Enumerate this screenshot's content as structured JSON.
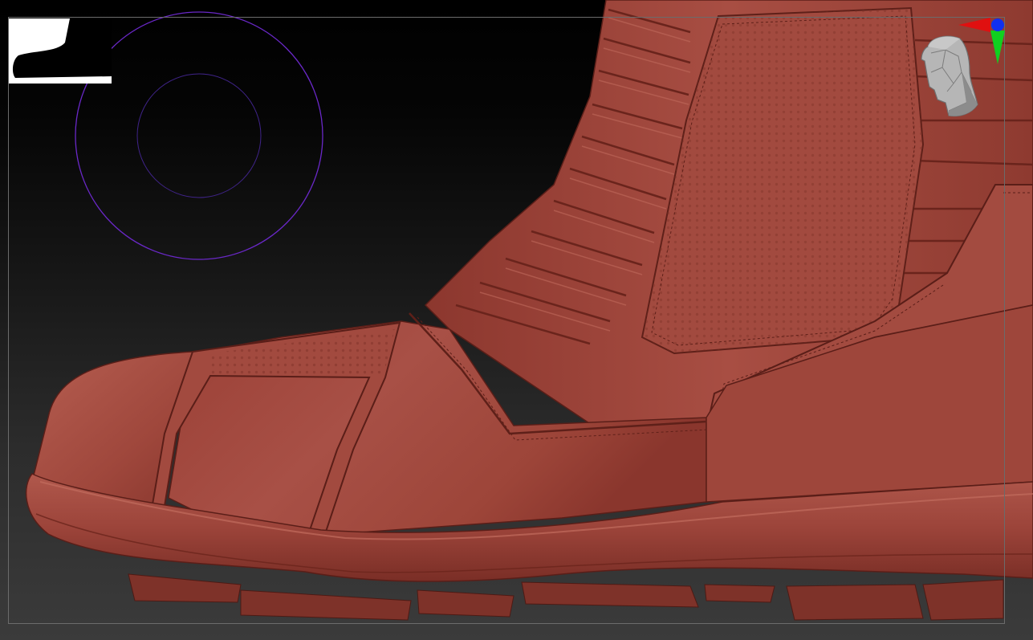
{
  "app": {
    "name": "",
    "view": "3d-viewport"
  },
  "viewport": {
    "background_top": "#000000",
    "background_bottom": "#3b3b3b",
    "frame_color": "#6b6b6b"
  },
  "model": {
    "subject": "boot",
    "material_color": "#a0463c",
    "highlight_color": "#c06a5c",
    "shadow_color": "#5a1e18"
  },
  "brush": {
    "outer_ring_color": "#6a28c8",
    "inner_ring_color": "#40248a"
  },
  "navigator": {
    "x_axis_color": "#e01010",
    "y_axis_color": "#10d020",
    "z_axis_color": "#1030f0",
    "icon": "head-icon"
  },
  "thumbnail": {
    "background": "#ffffff",
    "silhouette": "#000000"
  }
}
